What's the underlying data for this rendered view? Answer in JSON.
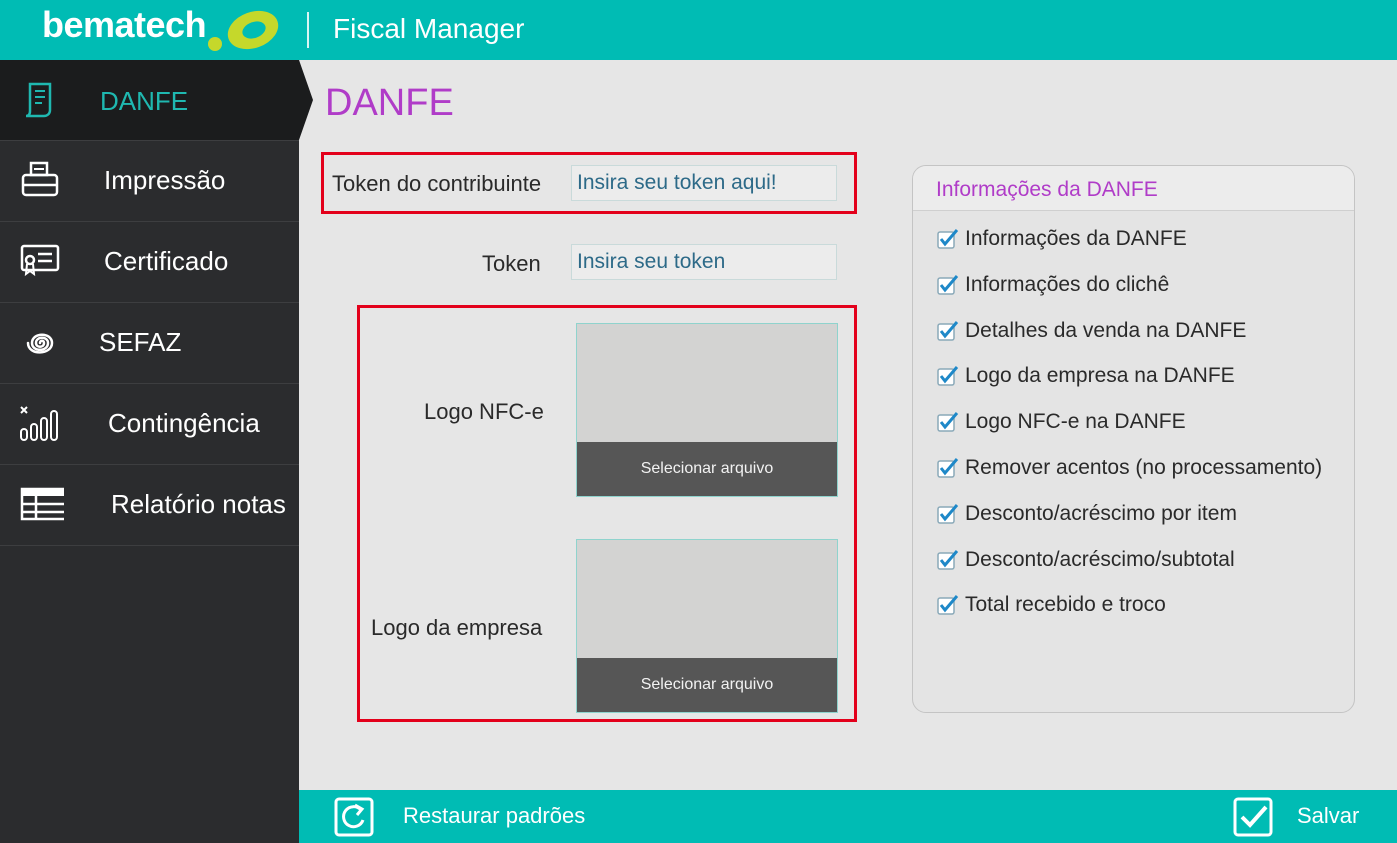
{
  "header": {
    "brand": "bematech",
    "app_title": "Fiscal Manager"
  },
  "sidebar": {
    "items": [
      {
        "label": "DANFE",
        "icon": "receipt-icon",
        "active": true
      },
      {
        "label": "Impressão",
        "icon": "printer-icon"
      },
      {
        "label": "Certificado",
        "icon": "certificate-icon"
      },
      {
        "label": "SEFAZ",
        "icon": "spiral-icon"
      },
      {
        "label": "Contingência",
        "icon": "signal-bars-icon"
      },
      {
        "label": "Relatório notas",
        "icon": "table-icon"
      }
    ]
  },
  "main": {
    "title": "DANFE",
    "token_contribuinte": {
      "label": "Token do contribuinte",
      "placeholder": "Insira seu token aqui!"
    },
    "token": {
      "label": "Token",
      "placeholder": "Insira seu token"
    },
    "logo_nfce": {
      "label": "Logo NFC-e",
      "button": "Selecionar arquivo"
    },
    "logo_empresa": {
      "label": "Logo da empresa",
      "button": "Selecionar arquivo"
    }
  },
  "panel": {
    "title": "Informações da DANFE",
    "options": [
      {
        "label": "Informações da DANFE",
        "checked": true
      },
      {
        "label": "Informações do clichê",
        "checked": true
      },
      {
        "label": "Detalhes da venda na DANFE",
        "checked": true
      },
      {
        "label": "Logo da empresa na DANFE",
        "checked": true
      },
      {
        "label": "Logo NFC-e na DANFE",
        "checked": true
      },
      {
        "label": "Remover acentos (no processamento)",
        "checked": true
      },
      {
        "label": "Desconto/acréscimo por item",
        "checked": true
      },
      {
        "label": "Desconto/acréscimo/subtotal",
        "checked": true
      },
      {
        "label": "Total recebido e troco",
        "checked": true
      }
    ]
  },
  "footer": {
    "restore_label": "Restaurar padrões",
    "save_label": "Salvar"
  },
  "colors": {
    "accent": "#00bcb4",
    "title": "#b03cc8",
    "sidebar_bg": "#2b2c2e",
    "highlight": "#e3001b",
    "checkbox": "#1e88c8"
  }
}
